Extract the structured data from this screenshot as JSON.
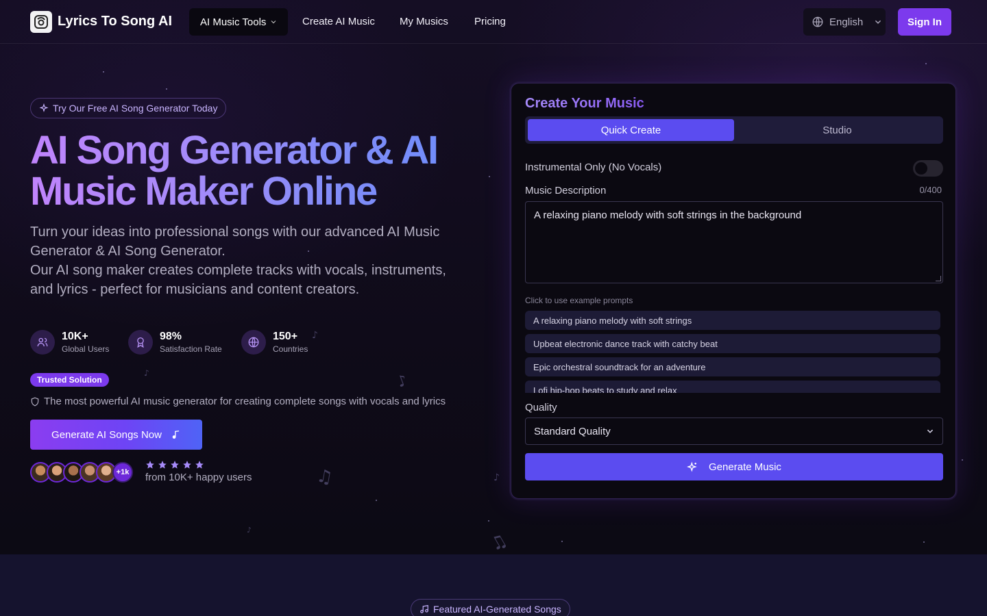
{
  "colors": {
    "accent": "#7c3aed",
    "button": "#5b4cf0",
    "background": "#0d0a16"
  },
  "nav": {
    "brand": "Lyrics To Song AI",
    "tools_label": "AI Music Tools",
    "links": [
      "Create AI Music",
      "My Musics",
      "Pricing"
    ],
    "language": "English",
    "signin": "Sign In"
  },
  "hero": {
    "pill": "Try Our Free AI Song Generator Today",
    "title_line1": "AI Song Generator & AI",
    "title_line2": "Music Maker Online",
    "desc_line1": "Turn your ideas into professional songs with our advanced AI Music Generator & AI Song Generator.",
    "desc_line2": "Our AI song maker creates complete tracks with vocals, instruments, and lyrics - perfect for musicians and content creators.",
    "stats": [
      {
        "value": "10K+",
        "label": "Global Users",
        "icon": "users-icon"
      },
      {
        "value": "98%",
        "label": "Satisfaction Rate",
        "icon": "award-icon"
      },
      {
        "value": "150+",
        "label": "Countries",
        "icon": "globe-icon"
      }
    ],
    "badge": "Trusted Solution",
    "trust_text": "The most powerful AI music generator for creating complete songs with vocals and lyrics",
    "cta": "Generate AI Songs Now",
    "avatars_more": "+1k",
    "rating_stars": 5,
    "happy_users": "from 10K+ happy users"
  },
  "card": {
    "title": "Create Your Music",
    "tabs": [
      "Quick Create",
      "Studio"
    ],
    "instrumental_label": "Instrumental Only (No Vocals)",
    "instrumental_on": false,
    "description_label": "Music Description",
    "char_count": "0/400",
    "description_value": "A relaxing piano melody with soft strings in the background",
    "prompt_hint": "Click to use example prompts",
    "prompts": [
      "A relaxing piano melody with soft strings",
      "Upbeat electronic dance track with catchy beat",
      "Epic orchestral soundtrack for an adventure",
      "Lofi hip-hop beats to study and relax"
    ],
    "quality_label": "Quality",
    "quality_value": "Standard Quality",
    "generate": "Generate Music"
  },
  "featured": {
    "pill": "Featured AI-Generated Songs"
  }
}
